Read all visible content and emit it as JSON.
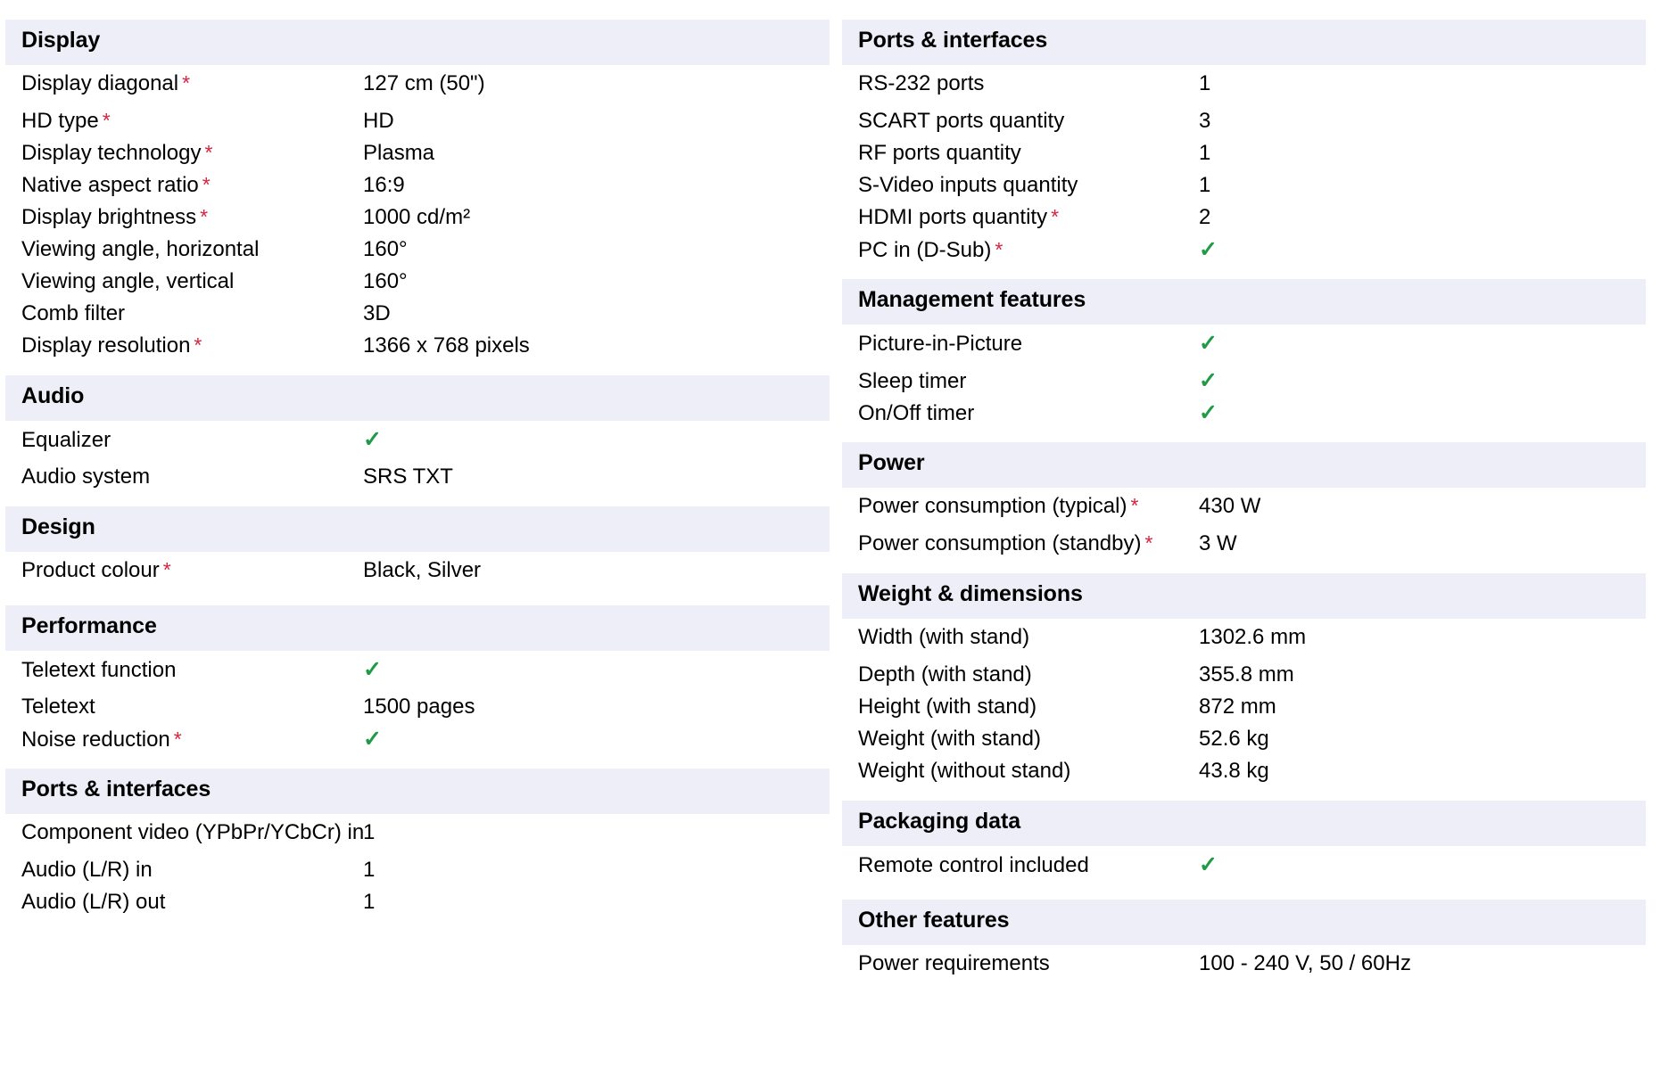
{
  "icons": {
    "check": "✓",
    "required_star": "*"
  },
  "colors": {
    "section_band": "#edeef8",
    "required_star": "#d9233f",
    "check": "#1f9b45",
    "text": "#000000",
    "background": "#ffffff"
  },
  "left_column": {
    "sections": [
      {
        "title": "Display",
        "rows": [
          {
            "label": "Display diagonal",
            "required": true,
            "value": "127 cm (50\")",
            "type": "text"
          },
          {
            "label": "HD type",
            "required": true,
            "value": "HD",
            "type": "text"
          },
          {
            "label": "Display technology",
            "required": true,
            "value": "Plasma",
            "type": "text"
          },
          {
            "label": "Native aspect ratio",
            "required": true,
            "value": "16:9",
            "type": "text"
          },
          {
            "label": "Display brightness",
            "required": true,
            "value": "1000 cd/m²",
            "type": "text"
          },
          {
            "label": "Viewing angle, horizontal",
            "required": false,
            "value": "160°",
            "type": "text"
          },
          {
            "label": "Viewing angle, vertical",
            "required": false,
            "value": "160°",
            "type": "text"
          },
          {
            "label": "Comb filter",
            "required": false,
            "value": "3D",
            "type": "text"
          },
          {
            "label": "Display resolution",
            "required": true,
            "value": "1366 x 768 pixels",
            "type": "text"
          }
        ]
      },
      {
        "title": "Audio",
        "rows": [
          {
            "label": "Equalizer",
            "required": false,
            "value": "✓",
            "type": "check"
          },
          {
            "label": "Audio system",
            "required": false,
            "value": "SRS TXT",
            "type": "text"
          }
        ]
      },
      {
        "title": "Design",
        "rows": [
          {
            "label": "Product colour",
            "required": true,
            "value": "Black, Silver",
            "type": "text"
          }
        ]
      },
      {
        "title": "Performance",
        "rows": [
          {
            "label": "Teletext function",
            "required": false,
            "value": "✓",
            "type": "check"
          },
          {
            "label": "Teletext",
            "required": false,
            "value": "1500 pages",
            "type": "text"
          },
          {
            "label": "Noise reduction",
            "required": true,
            "value": "✓",
            "type": "check"
          }
        ]
      },
      {
        "title": "Ports & interfaces",
        "rows": [
          {
            "label": "Component video (YPbPr/YCbCr) in",
            "required": false,
            "value": "1",
            "type": "text"
          },
          {
            "label": "Audio (L/R) in",
            "required": false,
            "value": "1",
            "type": "text"
          },
          {
            "label": "Audio (L/R) out",
            "required": false,
            "value": "1",
            "type": "text"
          }
        ]
      }
    ]
  },
  "right_column": {
    "sections": [
      {
        "title": "Ports & interfaces",
        "rows": [
          {
            "label": "RS-232 ports",
            "required": false,
            "value": "1",
            "type": "text"
          },
          {
            "label": "SCART ports quantity",
            "required": false,
            "value": "3",
            "type": "text"
          },
          {
            "label": "RF ports quantity",
            "required": false,
            "value": "1",
            "type": "text"
          },
          {
            "label": "S-Video inputs quantity",
            "required": false,
            "value": "1",
            "type": "text"
          },
          {
            "label": "HDMI ports quantity",
            "required": true,
            "value": "2",
            "type": "text"
          },
          {
            "label": "PC in (D-Sub)",
            "required": true,
            "value": "✓",
            "type": "check"
          }
        ]
      },
      {
        "title": "Management features",
        "rows": [
          {
            "label": "Picture-in-Picture",
            "required": false,
            "value": "✓",
            "type": "check"
          },
          {
            "label": "Sleep timer",
            "required": false,
            "value": "✓",
            "type": "check"
          },
          {
            "label": "On/Off timer",
            "required": false,
            "value": "✓",
            "type": "check"
          }
        ]
      },
      {
        "title": "Power",
        "rows": [
          {
            "label": "Power consumption (typical)",
            "required": true,
            "value": "430 W",
            "type": "text"
          },
          {
            "label": "Power consumption (standby)",
            "required": true,
            "value": "3 W",
            "type": "text"
          }
        ]
      },
      {
        "title": "Weight & dimensions",
        "rows": [
          {
            "label": "Width (with stand)",
            "required": false,
            "value": "1302.6 mm",
            "type": "text"
          },
          {
            "label": "Depth (with stand)",
            "required": false,
            "value": "355.8 mm",
            "type": "text"
          },
          {
            "label": "Height (with stand)",
            "required": false,
            "value": "872 mm",
            "type": "text"
          },
          {
            "label": "Weight (with stand)",
            "required": false,
            "value": "52.6 kg",
            "type": "text"
          },
          {
            "label": "Weight (without stand)",
            "required": false,
            "value": "43.8 kg",
            "type": "text"
          }
        ]
      },
      {
        "title": "Packaging data",
        "rows": [
          {
            "label": "Remote control included",
            "required": false,
            "value": "✓",
            "type": "check"
          }
        ]
      },
      {
        "title": "Other features",
        "rows": [
          {
            "label": "Power requirements",
            "required": false,
            "value": "100 - 240 V, 50 / 60Hz",
            "type": "text"
          }
        ]
      }
    ]
  }
}
